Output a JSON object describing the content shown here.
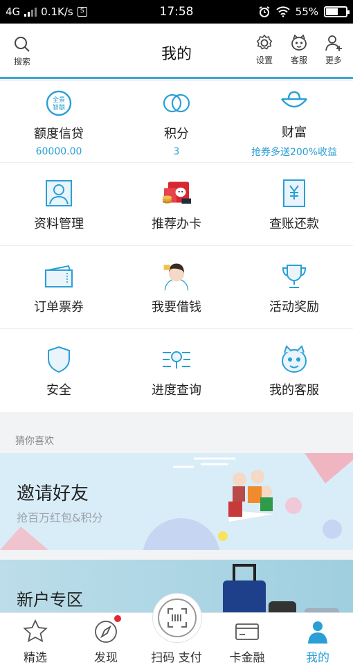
{
  "status": {
    "network": "4G",
    "speed": "0.1K/s",
    "sim_icon": "S",
    "time": "17:58",
    "battery": "55%",
    "battery_level": 0.55
  },
  "header": {
    "search_label": "搜索",
    "title": "我的",
    "settings_label": "设置",
    "service_label": "客服",
    "more_label": "更多"
  },
  "summary": [
    {
      "label": "额度信贷",
      "value": "60000.00",
      "icon": "quota-badge-icon",
      "badge_text": [
        "全景",
        "智额"
      ]
    },
    {
      "label": "积分",
      "value": "3",
      "icon": "points-icon"
    },
    {
      "label": "财富",
      "value": "抢券多送200%收益",
      "icon": "wealth-icon"
    }
  ],
  "grid": [
    {
      "label": "资料管理",
      "icon": "profile-icon"
    },
    {
      "label": "推荐办卡",
      "icon": "recommend-card-icon"
    },
    {
      "label": "查账还款",
      "icon": "bill-icon"
    },
    {
      "label": "订单票券",
      "icon": "ticket-icon"
    },
    {
      "label": "我要借钱",
      "icon": "borrow-icon"
    },
    {
      "label": "活动奖励",
      "icon": "trophy-icon"
    },
    {
      "label": "安全",
      "icon": "shield-icon"
    },
    {
      "label": "进度查询",
      "icon": "progress-search-icon"
    },
    {
      "label": "我的客服",
      "icon": "service-mascot-icon"
    }
  ],
  "recommend": {
    "heading": "猜你喜欢",
    "banner1_title": "邀请好友",
    "banner1_sub": "抢百万红包&积分",
    "banner2_title": "新户专区"
  },
  "tabs": [
    {
      "label": "精选",
      "icon": "star-icon"
    },
    {
      "label": "发现",
      "icon": "compass-icon"
    },
    {
      "label": "扫码 支付",
      "icon": "scan-pay-icon"
    },
    {
      "label": "卡金融",
      "icon": "card-icon"
    },
    {
      "label": "我的",
      "icon": "user-icon"
    }
  ],
  "colors": {
    "accent": "#2a9fd6",
    "badge": "#e5262e"
  }
}
